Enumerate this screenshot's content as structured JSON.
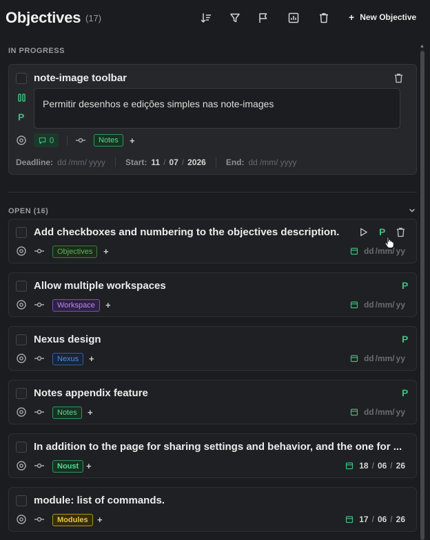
{
  "header": {
    "title": "Objectives",
    "count": "(17)",
    "toolbar": {
      "sort_icon": "sort-descending-icon",
      "filter_icon": "filter-icon",
      "flag_icon": "flag-icon",
      "chart_icon": "chart-icon",
      "trash_icon": "trash-icon",
      "new_label": "New Objective",
      "new_prefix": "+"
    }
  },
  "in_progress": {
    "label": "IN PROGRESS",
    "card": {
      "title": "note-image toolbar",
      "description": "Permitir desenhos e edições simples nas note-images",
      "priority": "P",
      "comments": "0",
      "tag": "Notes",
      "add": "+",
      "deadline_label": "Deadline:",
      "deadline_ph": {
        "dd": "dd",
        "mm": "/mm/",
        "yyyy": "yyyy"
      },
      "start_label": "Start:",
      "start": {
        "dd": "11",
        "mm": "07",
        "yyyy": "2026"
      },
      "end_label": "End:",
      "end_ph": {
        "dd": "dd",
        "mm": "/mm/",
        "yyyy": "yyyy"
      },
      "colors": {
        "accent": "#3fbf7f"
      }
    }
  },
  "open": {
    "label": "OPEN (16)",
    "items": [
      {
        "title": "Add checkboxes and numbering to the objectives description.",
        "tag": "Objectives",
        "add": "+",
        "priority": "P",
        "date": {
          "dd": "dd",
          "mm": "/mm/",
          "yy": "yy"
        }
      },
      {
        "title": "Allow multiple workspaces",
        "tag": "Workspace",
        "add": "+",
        "priority": "P",
        "date": {
          "dd": "dd",
          "mm": "/mm/",
          "yy": "yy"
        }
      },
      {
        "title": "Nexus design",
        "tag": "Nexus",
        "add": "+",
        "priority": "P",
        "date": {
          "dd": "dd",
          "mm": "/mm/",
          "yy": "yy"
        }
      },
      {
        "title": "Notes appendix feature",
        "tag": "Notes",
        "add": "+",
        "priority": "P",
        "date": {
          "dd": "dd",
          "mm": "/mm/",
          "yy": "yy"
        }
      },
      {
        "title": "In addition to the page for sharing settings and behavior, and the one for ...",
        "tag": "Noust",
        "add": "+",
        "date": {
          "dd": "18",
          "mm": "06",
          "yy": "26"
        }
      },
      {
        "title": "module: list of commands.",
        "tag": "Modules",
        "add": "+",
        "date": {
          "dd": "17",
          "mm": "06",
          "yy": "26"
        }
      }
    ]
  }
}
